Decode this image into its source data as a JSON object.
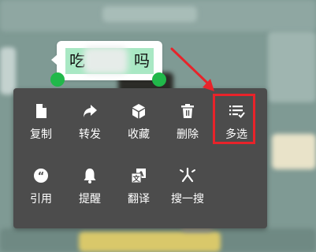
{
  "message": {
    "prefix": "吃",
    "suffix": "吗"
  },
  "menu": {
    "row1": [
      {
        "label": "复制",
        "icon": "file-copy-icon"
      },
      {
        "label": "转发",
        "icon": "forward-arrow-icon"
      },
      {
        "label": "收藏",
        "icon": "cube-favorite-icon"
      },
      {
        "label": "删除",
        "icon": "trash-icon"
      },
      {
        "label": "多选",
        "icon": "checklist-icon"
      }
    ],
    "row2": [
      {
        "label": "引用",
        "icon": "quote-icon"
      },
      {
        "label": "提醒",
        "icon": "bell-icon"
      },
      {
        "label": "翻译",
        "icon": "translate-icon"
      },
      {
        "label": "搜一搜",
        "icon": "search-sparkle-icon"
      }
    ]
  },
  "colors": {
    "menu_bg": "#4c4c4c",
    "selection": "#a9e8c4",
    "handle": "#21b84a",
    "annotation": "#e8232a"
  }
}
